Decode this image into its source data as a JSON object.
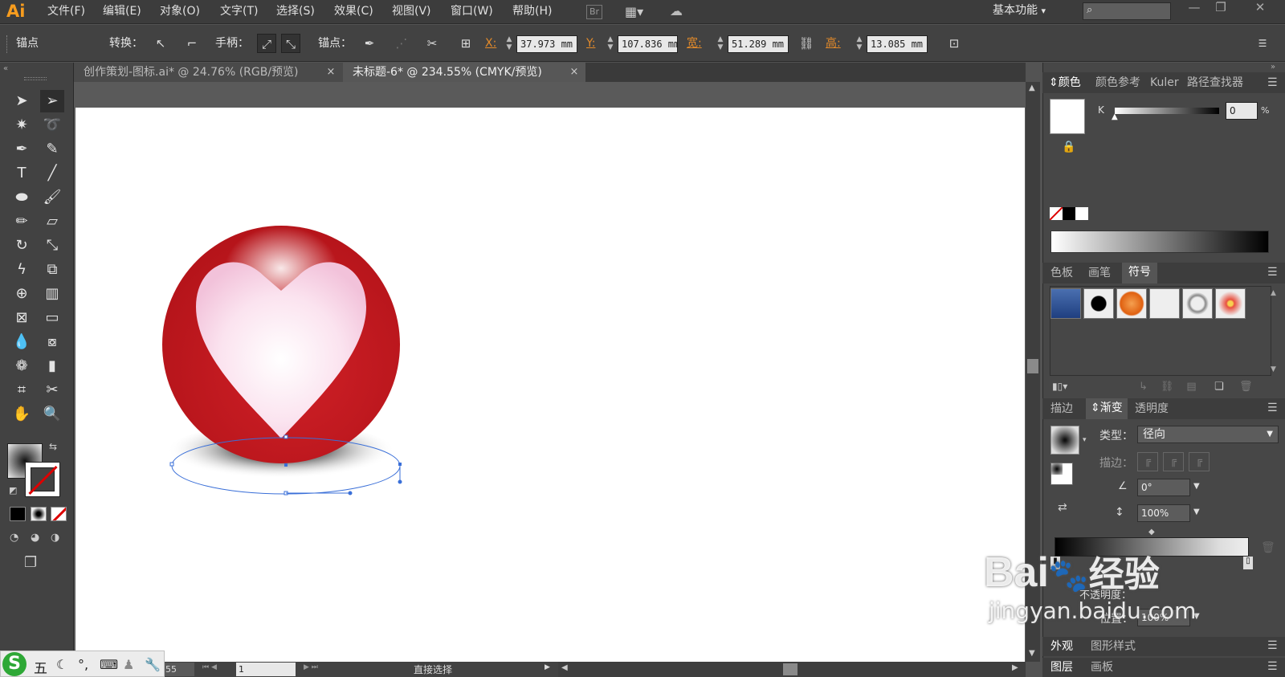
{
  "app": {
    "logo": "Ai"
  },
  "menubar": {
    "items": [
      "文件(F)",
      "编辑(E)",
      "对象(O)",
      "文字(T)",
      "选择(S)",
      "效果(C)",
      "视图(V)",
      "窗口(W)",
      "帮助(H)"
    ],
    "bridge_label": "Br",
    "workspace": "基本功能",
    "workspace_arrow": "▾"
  },
  "window_controls": {
    "minimize": "—",
    "restore": "❐",
    "close": "✕"
  },
  "control_bar": {
    "tool_name": "锚点",
    "convert_label": "转换：",
    "handles_label": "手柄：",
    "anchor_label": "锚点：",
    "x_label": "X:",
    "x_value": "37.973 mm",
    "y_label": "Y:",
    "y_value": "107.836 mm",
    "w_label": "宽:",
    "w_value": "51.289 mm",
    "h_label": "高:",
    "h_value": "13.085 mm"
  },
  "tabs": [
    {
      "label": "创作策划-图标.ai* @ 24.76% (RGB/预览)",
      "close": "×",
      "active": false
    },
    {
      "label": "未标题-6* @ 234.55% (CMYK/预览)",
      "close": "×",
      "active": true
    }
  ],
  "tools": [
    "select-arrow",
    "direct-select",
    "magic-wand",
    "lasso",
    "pen",
    "curvature-pen",
    "type",
    "line",
    "ellipse",
    "brush",
    "pencil",
    "eraser",
    "rotate",
    "scale",
    "warp",
    "free-transform",
    "shape-builder",
    "graph",
    "mesh",
    "gradient",
    "eyedropper",
    "blend",
    "symbol-sprayer",
    "column-graph",
    "artboard",
    "slice",
    "hand",
    "zoom"
  ],
  "color_panel": {
    "tabs": [
      "颜色",
      "颜色参考",
      "Kuler",
      "路径查找器"
    ],
    "channel_label": "K",
    "channel_value": "0",
    "unit": "%"
  },
  "swatch_panel": {
    "tabs": [
      "色板",
      "画笔",
      "符号"
    ],
    "active": "符号"
  },
  "gradient_panel": {
    "tabs": [
      "描边",
      "渐变",
      "透明度"
    ],
    "active": "渐变",
    "type_label": "类型：",
    "type_value": "径向",
    "stroke_label": "描边：",
    "angle_value": "0°",
    "aspect_value": "100%",
    "opacity_label": "不透明度：",
    "location_label": "位置：",
    "location_value": "100%"
  },
  "bottom_panels": {
    "appearance_tabs": [
      "外观",
      "图形样式"
    ],
    "layer_tabs": [
      "图层",
      "画板"
    ]
  },
  "status_bar": {
    "zoom": "55",
    "page": "1",
    "tool": "直接选择"
  },
  "ime": {
    "mode": "五",
    "icons": [
      "moon-icon",
      "punctuation-icon",
      "keyboard-icon",
      "user-icon",
      "wrench-icon"
    ]
  },
  "watermark": {
    "brand": "Bai",
    "brand_cn": "经验",
    "url": "jingyan.baidu.com"
  },
  "colors": {
    "accent_orange": "#e38a2a",
    "ball_red": "#c4161c",
    "selection_blue": "#3a6fd8"
  }
}
